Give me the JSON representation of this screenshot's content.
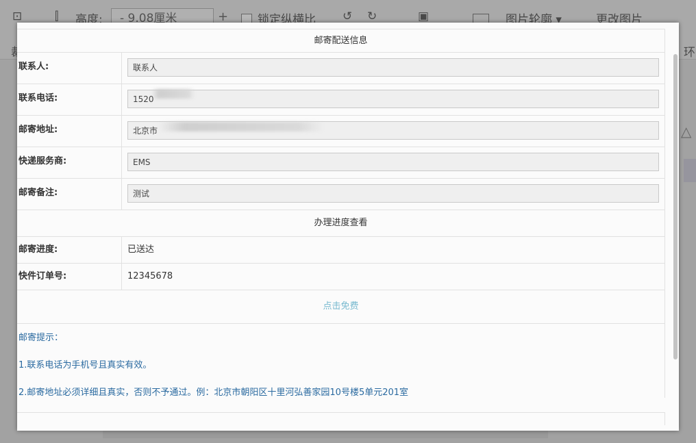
{
  "background": {
    "toolbar_height_label": "高度:",
    "toolbar_height_value": "- 9.08厘米",
    "toolbar_plus": "+",
    "toolbar_lock_label": "锁定纵横比",
    "toolbar_check_label": "图片轮廓 ▾",
    "toolbar_change_label": "更改图片",
    "left_char": "裁",
    "right_char": "环"
  },
  "dialog": {
    "shipping_section_title": "邮寄配送信息",
    "fields": {
      "contact_label": "联系人:",
      "contact_placeholder": "联系人",
      "phone_label": "联系电话:",
      "phone_value": "1520",
      "address_label": "邮寄地址:",
      "address_value": "北京市",
      "courier_label": "快递服务商:",
      "courier_value": "EMS",
      "remark_label": "邮寄备注:",
      "remark_value": "测试"
    },
    "progress_section_title": "办理进度查看",
    "progress": {
      "status_label": "邮寄进度:",
      "status_value": "已送达",
      "order_label": "快件订单号:",
      "order_value": "12345678"
    },
    "free_link": "点击免费",
    "tips": {
      "title": "邮寄提示：",
      "line1": "1.联系电话为手机号且真实有效。",
      "line2": "2.邮寄地址必须详细且真实，否则不予通过。例：北京市朝阳区十里河弘善家园10号楼5单元201室"
    }
  }
}
